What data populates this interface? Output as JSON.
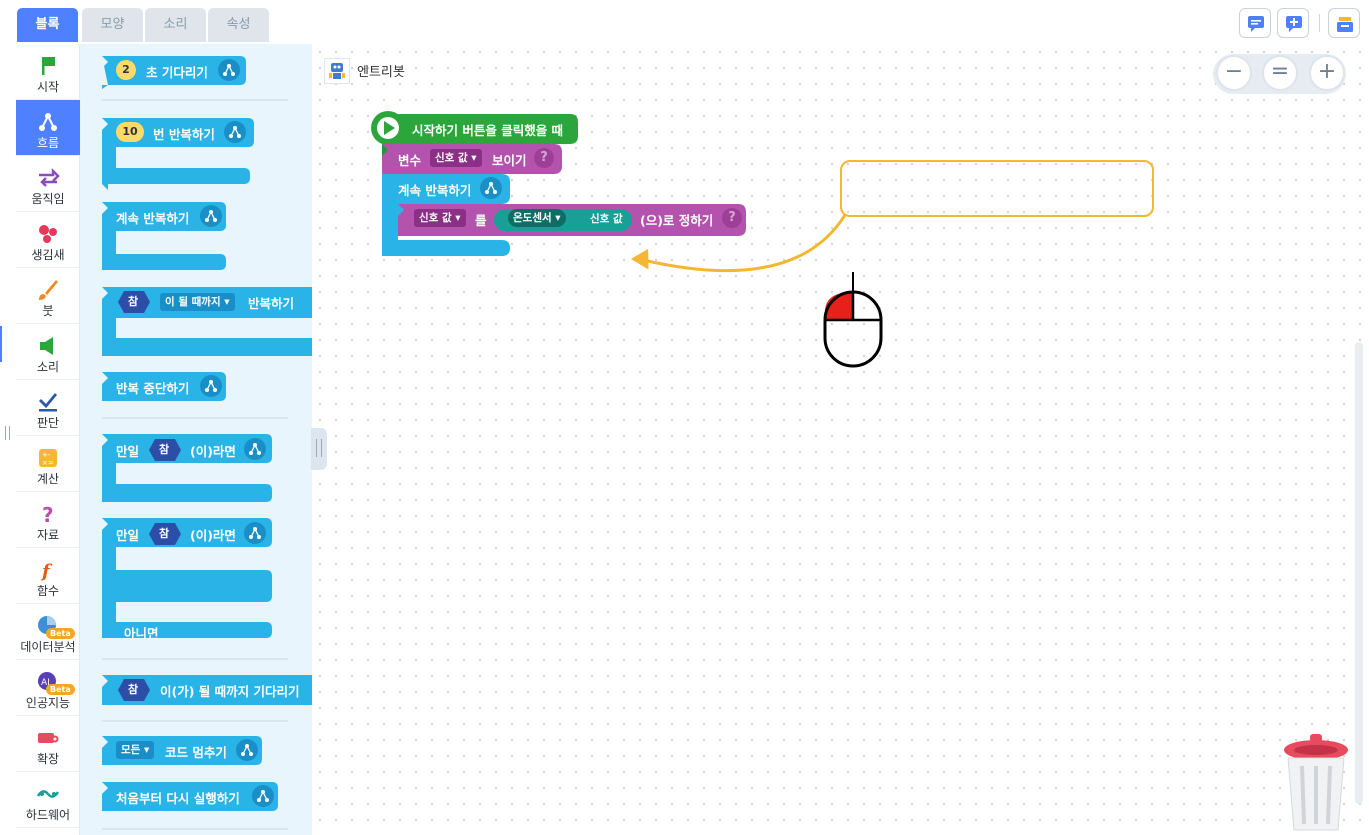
{
  "tabs": [
    "블록",
    "모양",
    "소리",
    "속성"
  ],
  "active_tab": "블록",
  "categories": [
    {
      "label": "시작",
      "icon": "flag-icon"
    },
    {
      "label": "흐름",
      "icon": "flow-icon"
    },
    {
      "label": "움직임",
      "icon": "move-arrows-icon"
    },
    {
      "label": "생김새",
      "icon": "looks-icon"
    },
    {
      "label": "붓",
      "icon": "brush-icon"
    },
    {
      "label": "소리",
      "icon": "speaker-icon"
    },
    {
      "label": "판단",
      "icon": "check-icon"
    },
    {
      "label": "계산",
      "icon": "calculator-icon"
    },
    {
      "label": "자료",
      "icon": "question-icon"
    },
    {
      "label": "함수",
      "icon": "function-icon"
    },
    {
      "label": "데이터분석",
      "icon": "pie-chart-icon",
      "badge": "Beta"
    },
    {
      "label": "인공지능",
      "icon": "ai-icon",
      "badge": "Beta"
    },
    {
      "label": "확장",
      "icon": "extension-icon"
    },
    {
      "label": "하드웨어",
      "icon": "hardware-icon"
    }
  ],
  "active_category": "흐름",
  "palette": {
    "wait": {
      "num": "2",
      "label": "초 기다리기"
    },
    "repeat_n": {
      "num": "10",
      "label": "번 반복하기"
    },
    "repeat_forever": "계속 반복하기",
    "repeat_until": {
      "cond": "참",
      "dropdown": "이 될 때까지",
      "label": "반복하기"
    },
    "stop_repeat": "반복 중단하기",
    "if1": {
      "prefix": "만일",
      "cond": "참",
      "suffix": "(이)라면"
    },
    "if2": {
      "prefix": "만일",
      "cond": "참",
      "suffix": "(이)라면",
      "else": "아니면"
    },
    "wait_until": {
      "cond": "참",
      "label": "이(가) 될 때까지 기다리기"
    },
    "stop_all": {
      "dropdown": "모든",
      "label": "코드 멈추기"
    },
    "restart": "처음부터 다시 실행하기"
  },
  "object_name": "엔트리봇",
  "script": {
    "start": "시작하기 버튼을 클릭했을 때",
    "show_var": {
      "prefix": "변수",
      "var": "신호 값",
      "suffix": "보이기"
    },
    "forever": "계속 반복하기",
    "set_var": {
      "var": "신호 값",
      "mid": "를",
      "sensor": "온도센서",
      "sensor_val": "신호 값",
      "suffix": "(으)로 정하기"
    }
  },
  "zoom": {
    "minus": "−",
    "reset": "=",
    "plus": "+"
  },
  "colors": {
    "accent": "#4f80ff",
    "flow": "#29b3e6",
    "start": "#2ca53b",
    "variable": "#b453ad",
    "hardware": "#18a096",
    "callout": "#f5b731"
  }
}
